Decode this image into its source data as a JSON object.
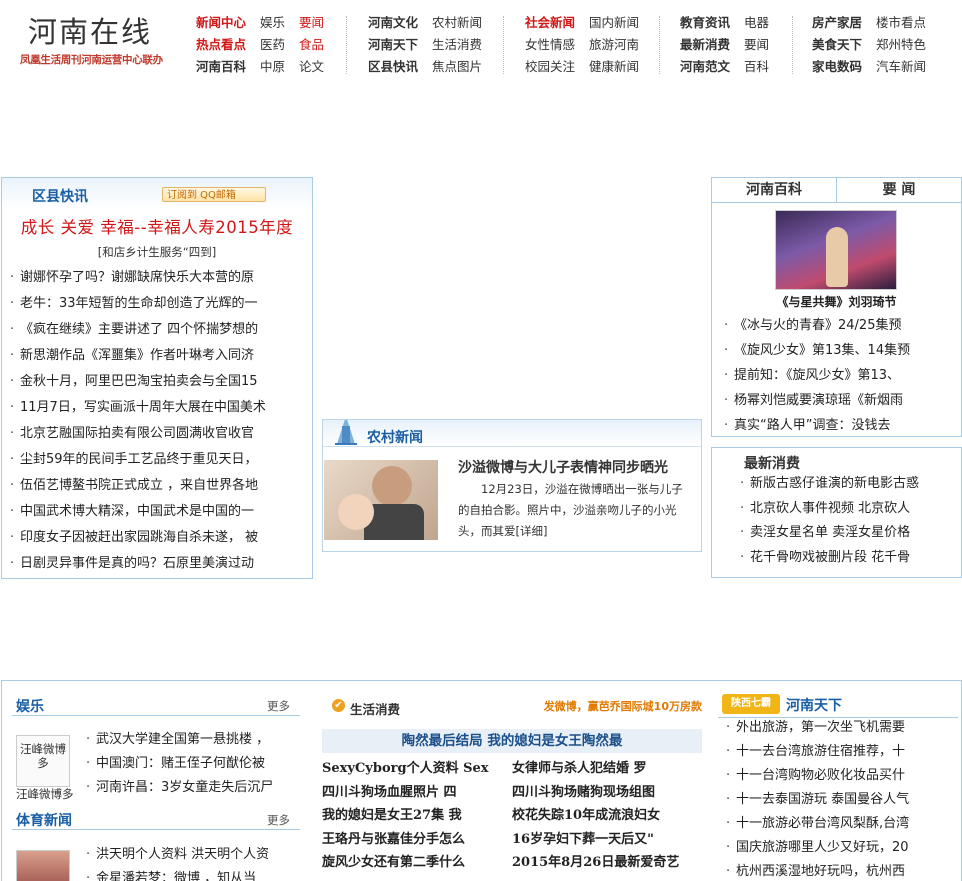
{
  "logo": {
    "title": "河南在线",
    "subtitle": "凤凰生活周刊河南运营中心联办"
  },
  "nav": {
    "g1": [
      [
        "新闻中心",
        "娱乐",
        "要闻"
      ],
      [
        "热点看点",
        "医药",
        "食品"
      ],
      [
        "河南百科",
        "中原",
        "论文"
      ]
    ],
    "g2": [
      [
        "河南文化",
        "农村新闻"
      ],
      [
        "河南天下",
        "生活消费"
      ],
      [
        "区县快讯",
        "焦点图片"
      ]
    ],
    "g3": [
      [
        "社会新闻",
        "国内新闻"
      ],
      [
        "女性情感",
        "旅游河南"
      ],
      [
        "校园关注",
        "健康新闻"
      ]
    ],
    "g4": [
      [
        "教育资讯",
        "电器"
      ],
      [
        "最新消费",
        "要闻"
      ],
      [
        "河南范文",
        "百科"
      ]
    ],
    "g5": [
      [
        "房产家居",
        "楼市看点"
      ],
      [
        "美食天下",
        "郑州特色"
      ],
      [
        "家电数码",
        "汽车新闻"
      ]
    ]
  },
  "district": {
    "title": "区县快讯",
    "subscribe": "订阅到 QQ邮箱",
    "promo": "成长 关爱 幸福--幸福人寿2015年度",
    "promo_sub": "[和店乡计生服务“四到]",
    "items": [
      "谢娜怀孕了吗？谢娜缺席快乐大本营的原",
      "老牛：33年短暂的生命却创造了光辉的一",
      "《疯在继续》主要讲述了 四个怀揣梦想的",
      "新思潮作品《浑噩集》作者叶琳考入同济",
      "金秋十月，阿里巴巴淘宝拍卖会与全国15",
      "11月7日，写实画派十周年大展在中国美术",
      "北京艺融国际拍卖有限公司圆满收官收官",
      "尘封59年的民间手工艺品终于重见天日，",
      "伍佰艺博鳌书院正式成立 ，来自世界各地",
      "中国武术博大精深，中国武术是中国的一",
      "印度女子因被赶出家园跳海自杀未遂， 被",
      "日剧灵异事件是真的吗？石原里美演过动"
    ]
  },
  "baike": {
    "tab1": "河南百科",
    "tab2": "要 闻",
    "caption": "《与星共舞》刘羽琦节",
    "items": [
      "《冰与火的青春》24/25集预",
      "《旋风少女》第13集、14集预",
      "提前知：《旋风少女》第13、",
      "杨幂刘恺威要演琼瑶《新烟雨",
      "真实“路人甲”调查：没钱去"
    ]
  },
  "rural": {
    "title": "农村新闻",
    "headline": "沙溢微博与大儿子表情神同步晒光",
    "desc": "12月23日，沙溢在微博晒出一张与儿子的自拍合影。照片中，沙溢亲吻儿子的小光头，而其爱",
    "more": "[详细]"
  },
  "latest": {
    "title": "最新消费",
    "items": [
      "新版古惑仔谁演的新电影古惑",
      "北京砍人事件视频 北京砍人",
      "卖淫女星名单 卖淫女星价格",
      "花千骨吻戏被删片段 花千骨"
    ]
  },
  "entertainment": {
    "title": "娱乐",
    "more": "更多",
    "thumb_text": "汪峰微博多",
    "thumb_caption": "汪峰微博多",
    "items": [
      "武汉大学建全国第一悬挑楼 ，",
      "中国澳门：赌王侄子何猷伦被",
      "河南许昌：3岁女童走失后沉尸"
    ]
  },
  "sports": {
    "title": "体育新闻",
    "more": "更多",
    "items": [
      "洪天明个人资料 洪天明个人资",
      "金星潘若梦：微博 ，知从当"
    ]
  },
  "life": {
    "title": "生活消费",
    "promo": "发微博，赢芭乔国际城10万房款",
    "banner": "陶然最后结局 我的媳妇是女王陶然最",
    "col1": [
      "SexyCyborg个人资料 Sex",
      "四川斗狗场血腥照片 四",
      "我的媳妇是女王27集 我",
      "王珞丹与张嘉佳分手怎么",
      "旋风少女还有第二季什么"
    ],
    "col2": [
      "女律师与杀人犯结婚 罗",
      "四川斗狗场赌狗现场组图",
      "校花失踪10年成流浪妇女",
      "16岁孕妇下葬一天后又\"",
      "2015年8月26日最新爱奇艺"
    ]
  },
  "henan": {
    "badge": "陕西七霸",
    "title": "河南天下",
    "items": [
      "外出旅游，第一次坐飞机需要",
      "十一去台湾旅游住宿推荐，十",
      "十一台湾购物必败化妆品买什",
      "十一去泰国游玩 泰国曼谷人气",
      "十一旅游必带台湾风梨酥,台湾",
      "国庆旅游哪里人少又好玩，20",
      "杭州西溪湿地好玩吗，杭州西"
    ]
  }
}
